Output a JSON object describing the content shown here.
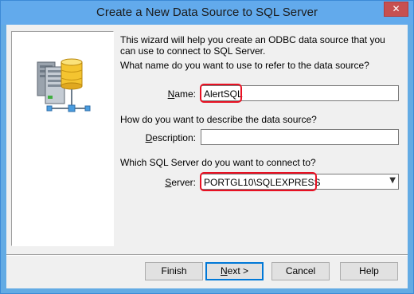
{
  "window": {
    "title": "Create a New Data Source to SQL Server",
    "close_glyph": "✕"
  },
  "intro_text": "This wizard will help you create an ODBC data source that you can use to connect to SQL Server.",
  "name_section": {
    "question": "What name do you want to use to refer to the data source?",
    "label_hotkey": "N",
    "label_rest": "ame:",
    "value": "AlertSQL"
  },
  "description_section": {
    "question": "How do you want to describe the data source?",
    "label_hotkey": "D",
    "label_rest": "escription:",
    "value": ""
  },
  "server_section": {
    "question": "Which SQL Server do you want to connect to?",
    "label_hotkey": "S",
    "label_rest": "erver:",
    "value": "PORTGL10\\SQLEXPRESS",
    "dropdown_icon": "chevron-down-icon"
  },
  "buttons": {
    "finish": "Finish",
    "next_hotkey": "N",
    "next_rest": "ext >",
    "cancel": "Cancel",
    "help": "Help"
  },
  "colors": {
    "highlight": "#e81123",
    "titlebar": "#62aaec",
    "close_button": "#c75050",
    "default_button_border": "#0078d7"
  }
}
